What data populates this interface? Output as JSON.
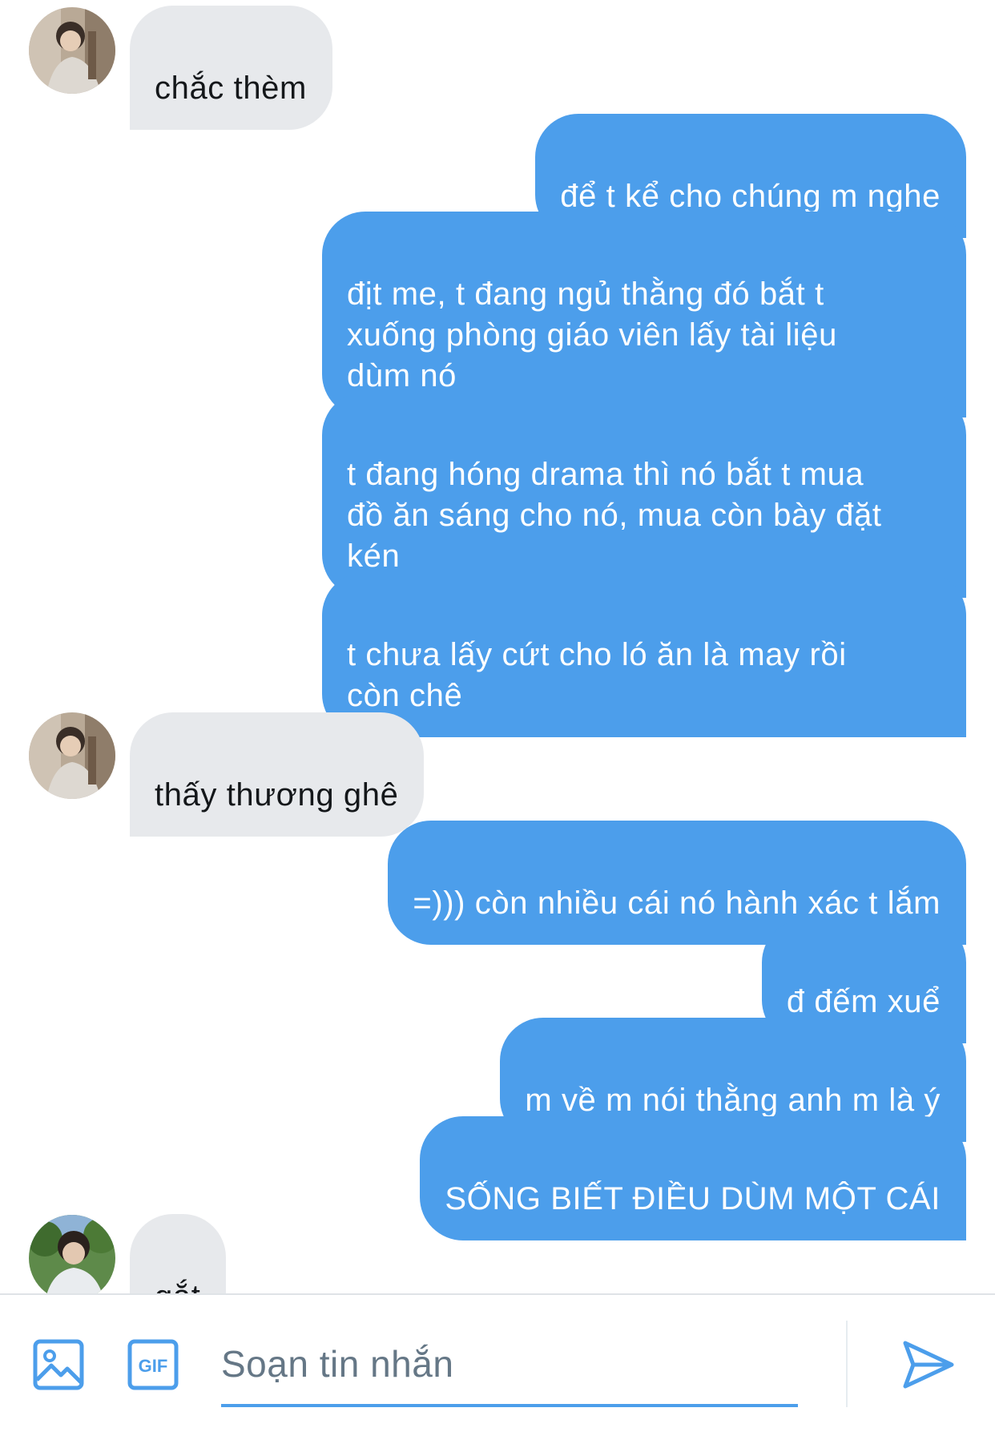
{
  "messages": [
    {
      "id": "m1",
      "side": "in",
      "text": "chắc thèm",
      "avatar": "avatar-1"
    },
    {
      "id": "m2",
      "side": "out",
      "text": "để t kể cho chúng m nghe"
    },
    {
      "id": "m3",
      "side": "out",
      "text": "địt me, t đang ngủ thằng đó bắt t\nxuống phòng giáo viên lấy tài liệu\ndùm nó"
    },
    {
      "id": "m4",
      "side": "out",
      "text": "t đang hóng drama thì nó bắt t mua\nđồ ăn sáng cho nó, mua còn bày đặt\nkén"
    },
    {
      "id": "m5",
      "side": "out",
      "text": "t chưa lấy cứt cho ló ăn là may rồi\ncòn chê"
    },
    {
      "id": "m6",
      "side": "in",
      "text": "thấy thương ghê",
      "avatar": "avatar-1"
    },
    {
      "id": "m7",
      "side": "out",
      "text": "=))) còn nhiều cái nó hành xác t lắm"
    },
    {
      "id": "m8",
      "side": "out",
      "text": "đ đếm xuể"
    },
    {
      "id": "m9",
      "side": "out",
      "text": "m về m nói thằng anh m là ý"
    },
    {
      "id": "m10",
      "side": "out",
      "text": "SỐNG BIẾT ĐIỀU DÙM MỘT CÁI"
    },
    {
      "id": "m11",
      "side": "in",
      "text": "gắt",
      "avatar": "avatar-2"
    }
  ],
  "composer": {
    "placeholder": "Soạn tin nhắn",
    "image_icon": "image-icon",
    "gif_icon": "gif-icon",
    "gif_label": "GIF",
    "send_icon": "send-icon"
  },
  "colors": {
    "accent": "#4c9eeb",
    "incoming_bubble": "#e7e9ec",
    "incoming_text": "#14171a",
    "outgoing_text": "#ffffff",
    "placeholder": "#657786"
  }
}
